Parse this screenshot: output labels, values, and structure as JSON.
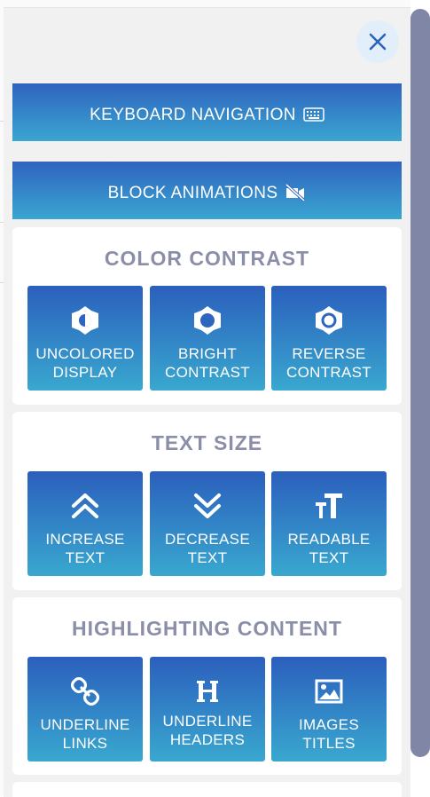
{
  "panel": {
    "close_icon": "close-icon",
    "keyboard_navigation": "KEYBOARD NAVIGATION",
    "block_animations": "BLOCK ANIMATIONS"
  },
  "color_contrast": {
    "title": "COLOR CONTRAST",
    "tiles": [
      {
        "line1": "UNCOLORED",
        "line2": "DISPLAY",
        "icon": "half-circle-contrast-icon"
      },
      {
        "line1": "BRIGHT",
        "line2": "CONTRAST",
        "icon": "sun-outline-icon"
      },
      {
        "line1": "REVERSE",
        "line2": "CONTRAST",
        "icon": "sun-filled-icon"
      }
    ]
  },
  "text_size": {
    "title": "TEXT SIZE",
    "tiles": [
      {
        "line1": "INCREASE",
        "line2": "TEXT",
        "icon": "double-chevron-up-icon"
      },
      {
        "line1": "DECREASE",
        "line2": "TEXT",
        "icon": "double-chevron-down-icon"
      },
      {
        "line1": "READABLE",
        "line2": "TEXT",
        "icon": "text-height-icon"
      }
    ]
  },
  "highlighting": {
    "title": "HIGHLIGHTING CONTENT",
    "tiles": [
      {
        "line1": "UNDERLINE",
        "line2": "LINKS",
        "icon": "link-icon"
      },
      {
        "line1": "UNDERLINE",
        "line2": "HEADERS",
        "icon": "heading-icon"
      },
      {
        "line1": "IMAGES",
        "line2": "TITLES",
        "icon": "image-icon"
      }
    ]
  },
  "colors": {
    "gradient_top": "#2b5fbd",
    "gradient_bottom": "#39a8cf",
    "section_title": "#8a8ea8",
    "scrollbar": "#7f86a6",
    "close_bg": "#e3eefb",
    "close_x": "#2c63b6"
  }
}
